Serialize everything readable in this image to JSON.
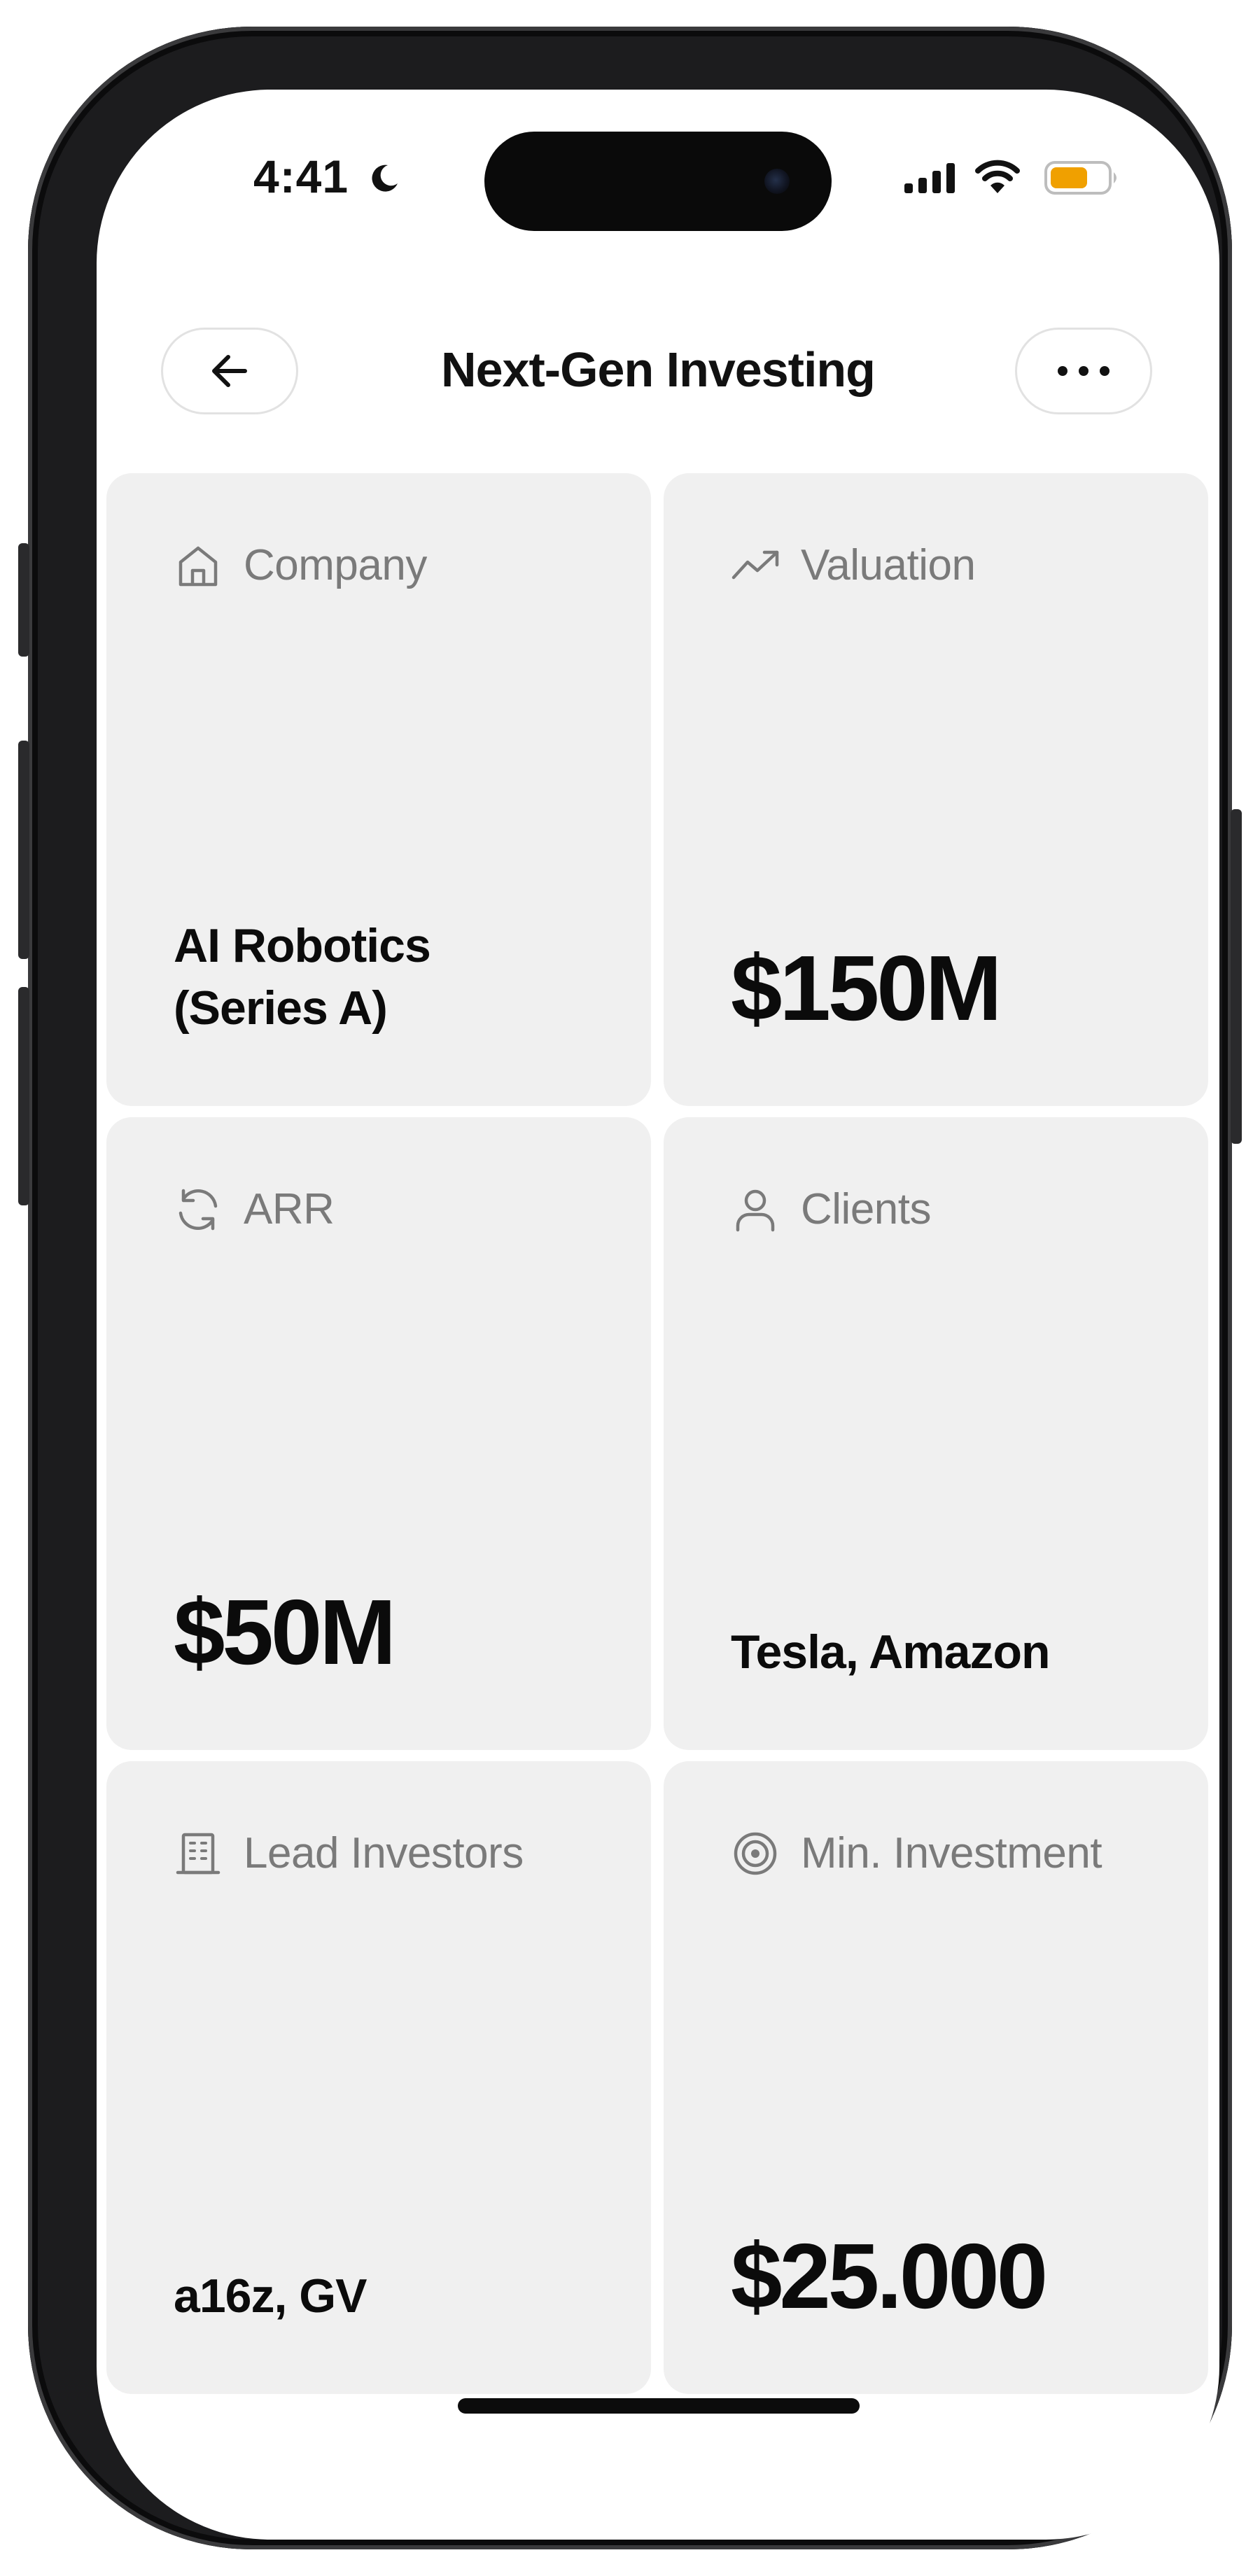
{
  "status_bar": {
    "time": "4:41",
    "battery_color": "#F0A000"
  },
  "header": {
    "title": "Next-Gen Investing"
  },
  "cards": [
    {
      "label": "Company",
      "icon": "home-icon",
      "value_line1": "AI Robotics",
      "value_line2": "(Series A)"
    },
    {
      "label": "Valuation",
      "icon": "trending-up-icon",
      "value": "$150M"
    },
    {
      "label": "ARR",
      "icon": "refresh-icon",
      "value": "$50M"
    },
    {
      "label": "Clients",
      "icon": "user-icon",
      "value": "Tesla, Amazon"
    },
    {
      "label": "Lead Investors",
      "icon": "building-icon",
      "value": "a16z, GV"
    },
    {
      "label": "Min. Investment",
      "icon": "target-icon",
      "value": "$25.000"
    }
  ],
  "colors": {
    "card_background": "#F0F0F0",
    "label_gray": "#7A7A7A",
    "value_black": "#0B0B0B"
  }
}
